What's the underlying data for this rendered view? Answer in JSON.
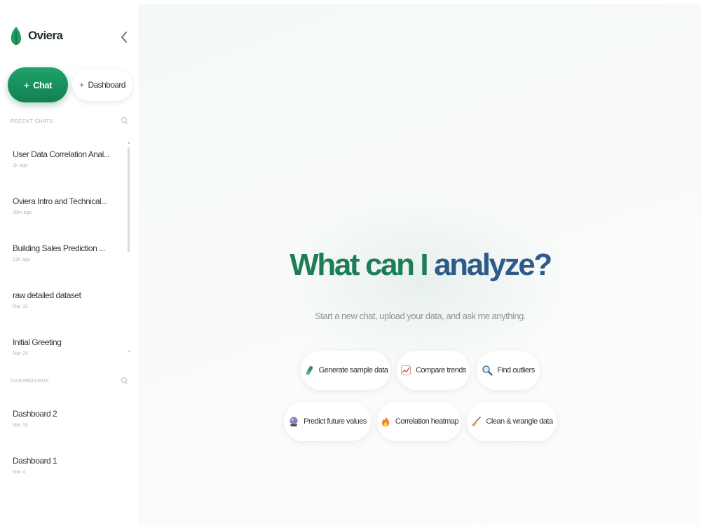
{
  "brand": {
    "name": "Oviera"
  },
  "buttons": {
    "chat": "Chat",
    "dashboard": "Dashboard",
    "plus": "+"
  },
  "recent": {
    "label": "RECENT CHATS",
    "items": [
      {
        "title": "User Data Correlation Anal...",
        "time": "1h ago"
      },
      {
        "title": "Oviera Intro and Technical...",
        "time": "38m ago"
      },
      {
        "title": "Building Sales Prediction ...",
        "time": "21h ago"
      },
      {
        "title": "raw detailed dataset",
        "time": "Mar 31"
      },
      {
        "title": "Initial Greeting",
        "time": "Mar 26"
      }
    ]
  },
  "dashboards": {
    "label": "DASHBOARDS",
    "items": [
      {
        "title": "Dashboard 2",
        "time": "Mar 16"
      },
      {
        "title": "Dashboard 1",
        "time": "Mar 4"
      }
    ]
  },
  "hero": {
    "title_part1": "What can I ",
    "title_part2": "analyze?",
    "subtitle": "Start a new chat, upload your data, and ask me anything."
  },
  "suggestions": [
    {
      "label": "Generate sample data",
      "icon": "test-tube-icon"
    },
    {
      "label": "Compare trends",
      "icon": "chart-trend-icon"
    },
    {
      "label": "Find outliers",
      "icon": "magnifier-icon"
    },
    {
      "label": "Predict future values",
      "icon": "crystal-ball-icon"
    },
    {
      "label": "Correlation heatmap",
      "icon": "fire-icon"
    },
    {
      "label": "Clean & wrangle data",
      "icon": "broom-icon"
    }
  ],
  "colors": {
    "accent_green": "#1c7d57",
    "accent_blue": "#2e5b8a",
    "chat_button": "#1a9463"
  }
}
